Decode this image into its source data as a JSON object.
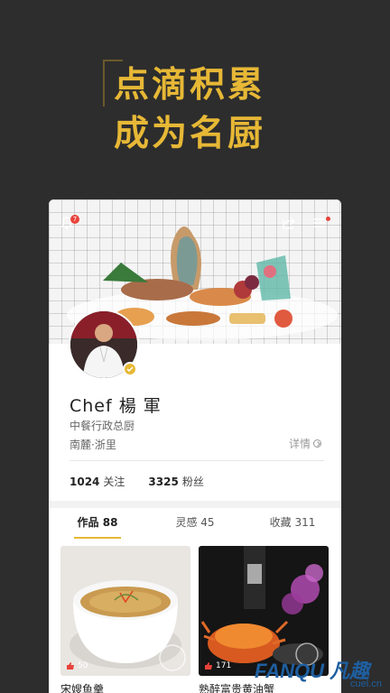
{
  "hero": {
    "line1": "点滴积累",
    "line2": "成为名厨"
  },
  "header": {
    "notification_count": "7"
  },
  "profile": {
    "name": "Chef 楊 軍",
    "title": "中餐行政总厨",
    "location": "南麓·浙里",
    "detail_label": "详情"
  },
  "stats": {
    "following_count": "1024",
    "following_label": "关注",
    "followers_count": "3325",
    "followers_label": "粉丝"
  },
  "tabs": [
    {
      "label": "作品 88",
      "active": true
    },
    {
      "label": "灵感 45",
      "active": false
    },
    {
      "label": "收藏 311",
      "active": false
    }
  ],
  "posts": [
    {
      "title": "宋嫂鱼羹",
      "likes": "50"
    },
    {
      "title": "熟醉富贵黄油蟹",
      "likes": "171"
    }
  ],
  "watermark": {
    "main": "FANQU 凡趣",
    "sub": "cuel.cn"
  },
  "colors": {
    "accent": "#e7b836",
    "background": "#2d2d2d",
    "badge": "#e8433a"
  }
}
